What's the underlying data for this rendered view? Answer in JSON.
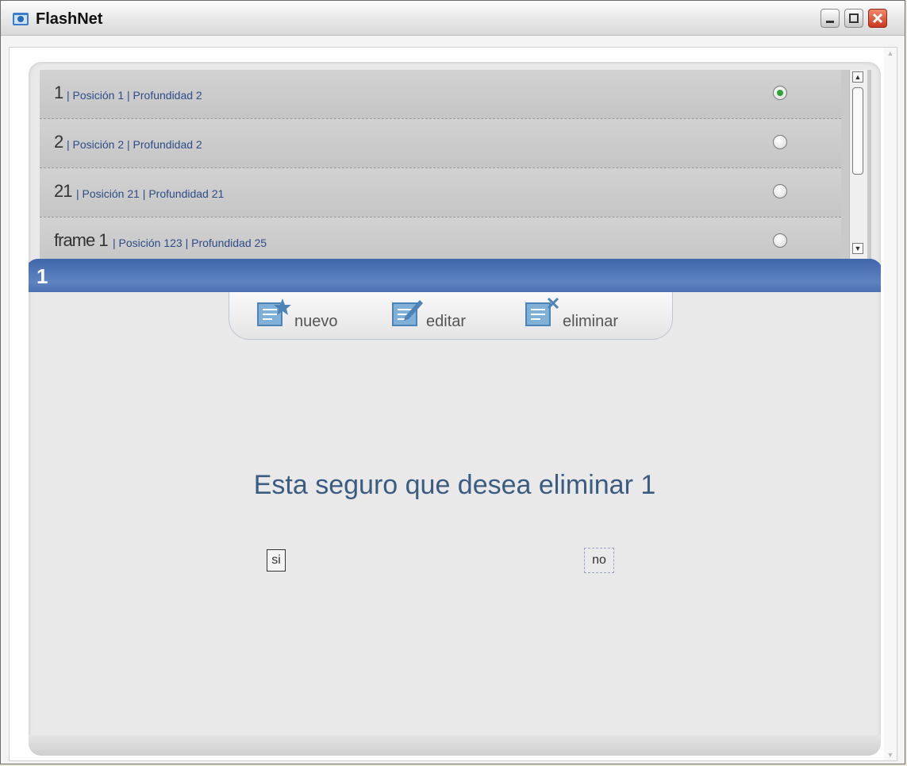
{
  "window": {
    "title": "FlashNet"
  },
  "list": {
    "items": [
      {
        "id": "1",
        "position_text": "| Posición 1  | Profundidad  2",
        "selected": true
      },
      {
        "id": "2",
        "position_text": "| Posición 2  | Profundidad  2",
        "selected": false
      },
      {
        "id": "21",
        "position_text": "| Posición 21  | Profundidad  21",
        "selected": false
      },
      {
        "id": "frame 1",
        "position_text": "| Posición 123  | Profundidad  25",
        "selected": false
      }
    ]
  },
  "panel": {
    "title": "1"
  },
  "toolbar": {
    "nuevo": "nuevo",
    "editar": "editar",
    "eliminar": "eliminar"
  },
  "dialog": {
    "message": "Esta seguro que desea eliminar 1",
    "yes": "si",
    "no": "no"
  },
  "colors": {
    "accent": "#4a70b1",
    "text_link": "#2d4c86",
    "selected_radio": "#2da33b"
  }
}
